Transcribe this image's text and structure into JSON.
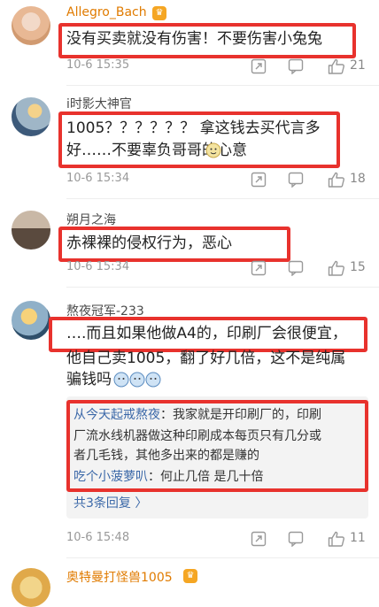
{
  "comments": [
    {
      "username": "Allegro_Bach",
      "text": "没有买卖就没有伤害！不要伤害小兔兔",
      "date": "10-6 15:35",
      "likes": "21"
    },
    {
      "username": "i时影大神官",
      "text_line1": "1005？？？？？？ 拿这钱去买代言多",
      "text_line2": "好……不要辜负哥哥的心意",
      "date": "10-6 15:34",
      "likes": "18"
    },
    {
      "username": "朔月之海",
      "text": "赤裸裸的侵权行为，恶心",
      "date": "10-6 15:34",
      "likes": "15"
    },
    {
      "username": "熬夜冠军-233",
      "text_line1": "….而且如果他做A4的，印刷厂会很便宜，",
      "text_line2": "他自己卖1005，翻了好几倍，这不是纯属",
      "text_line3": "骗钱吗",
      "replies": [
        {
          "name": "从今天起戒熬夜",
          "line1": "：我家就是开印刷厂的，印刷",
          "line2": "厂流水线机器做这种印刷成本每页只有几分或",
          "line3": "者几毛钱，其他多出来的都是赚的"
        },
        {
          "name": "吃个小菠萝叭",
          "line1": "：何止几倍 是几十倍"
        }
      ],
      "more_replies": "共3条回复 〉",
      "date": "10-6 15:48",
      "likes": "11"
    },
    {
      "username": "奥特曼打怪兽1005"
    }
  ],
  "colors": {
    "highlight_border": "#e8322d",
    "link": "#3b68a8",
    "gold_name": "#e07b00"
  },
  "icons": [
    "share-icon",
    "comment-icon",
    "like-icon",
    "vip-crown-icon",
    "emoji-icon"
  ]
}
